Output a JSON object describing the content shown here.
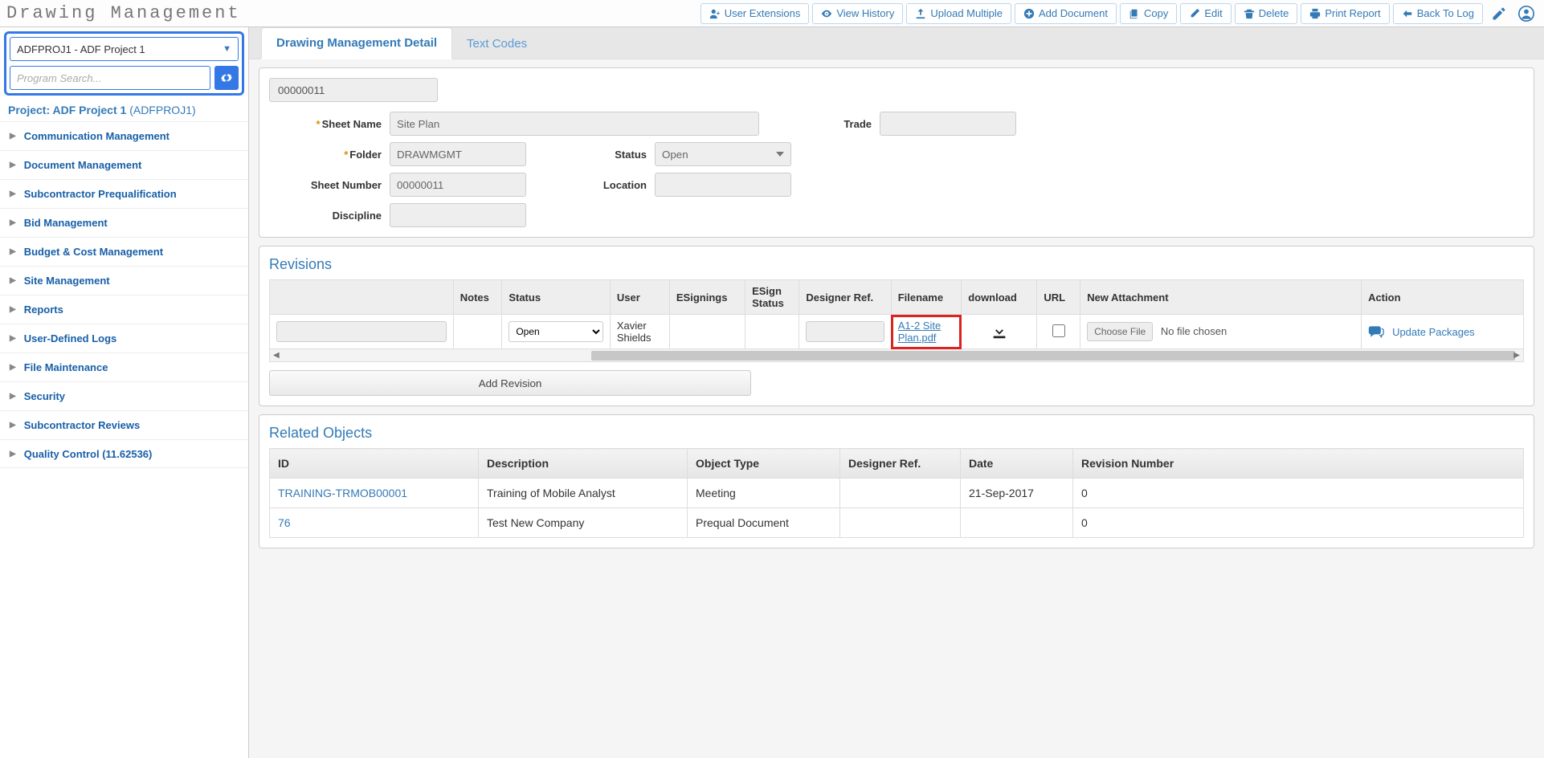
{
  "header": {
    "title": "Drawing Management",
    "buttons": {
      "user_ext": "User Extensions",
      "view_hist": "View History",
      "upload_multi": "Upload Multiple",
      "add_doc": "Add Document",
      "copy": "Copy",
      "edit": "Edit",
      "delete": "Delete",
      "print": "Print Report",
      "back": "Back To Log"
    }
  },
  "sidebar": {
    "project_dropdown": "ADFPROJ1 - ADF Project 1",
    "search_placeholder": "Program Search...",
    "project_label_prefix": "Project: ADF Project 1",
    "project_code": "(ADFPROJ1)",
    "items": [
      "Communication Management",
      "Document Management",
      "Subcontractor Prequalification",
      "Bid Management",
      "Budget & Cost Management",
      "Site Management",
      "Reports",
      "User-Defined Logs",
      "File Maintenance",
      "Security",
      "Subcontractor Reviews",
      "Quality Control (11.62536)"
    ]
  },
  "tabs": {
    "active": "Drawing Management Detail",
    "other": "Text Codes"
  },
  "detail": {
    "id_value": "00000011",
    "labels": {
      "sheet_name": "Sheet Name",
      "folder": "Folder",
      "sheet_number": "Sheet Number",
      "discipline": "Discipline",
      "trade": "Trade",
      "status": "Status",
      "location": "Location"
    },
    "values": {
      "sheet_name": "Site Plan",
      "folder": "DRAWMGMT",
      "sheet_number": "00000011",
      "discipline": "",
      "trade": "",
      "status": "Open",
      "location": ""
    }
  },
  "revisions": {
    "title": "Revisions",
    "headers": {
      "notes": "Notes",
      "status": "Status",
      "user": "User",
      "esignings": "ESignings",
      "esign_status": "ESign Status",
      "designer_ref": "Designer Ref.",
      "filename": "Filename",
      "download": "download",
      "url": "URL",
      "new_attachment": "New Attachment",
      "action": "Action"
    },
    "row": {
      "status": "Open",
      "user": "Xavier Shields",
      "filename": "A1-2 Site Plan.pdf",
      "choose_file": "Choose File",
      "no_file": "No file chosen",
      "update_pkg": "Update Packages"
    },
    "add_revision": "Add Revision"
  },
  "related": {
    "title": "Related Objects",
    "headers": {
      "id": "ID",
      "description": "Description",
      "object_type": "Object Type",
      "designer_ref": "Designer Ref.",
      "date": "Date",
      "revision_number": "Revision Number"
    },
    "rows": [
      {
        "id": "TRAINING-TRMOB00001",
        "description": "Training of Mobile Analyst",
        "object_type": "Meeting",
        "designer_ref": "",
        "date": "21-Sep-2017",
        "rev": "0"
      },
      {
        "id": "76",
        "description": "Test New Company",
        "object_type": "Prequal Document",
        "designer_ref": "",
        "date": "",
        "rev": "0"
      }
    ]
  }
}
